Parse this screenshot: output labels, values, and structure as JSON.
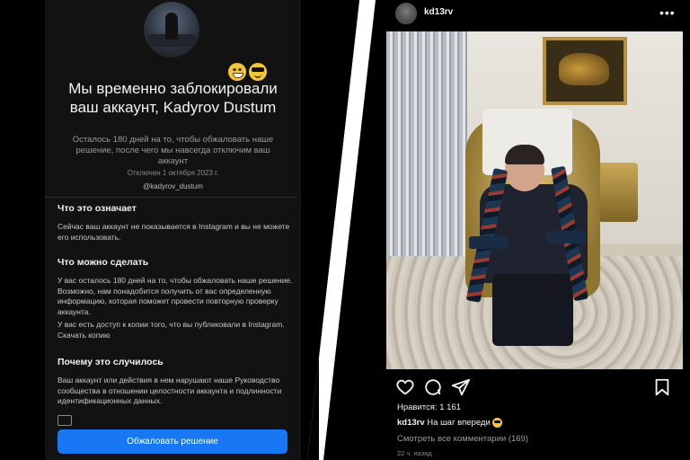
{
  "left_screen": {
    "title": "Мы временно заблокировали ваш аккаунт, Kadyrov Dustum",
    "subtitle": "Осталось 180 дней на то, чтобы обжаловать наше решение, после чего мы навсегда отключим ваш аккаунт",
    "disabled_date": "Отключен 1 октября 2023 г.",
    "handle": "@kadyrov_dustum",
    "sections": [
      {
        "heading": "Что это означает",
        "paragraphs": [
          "Сейчас ваш аккаунт не показывается в Instagram и вы не можете его использовать."
        ]
      },
      {
        "heading": "Что можно сделать",
        "paragraphs": [
          "У вас осталось 180 дней на то, чтобы обжаловать наше решение. Возможно, нам понадобится получить от вас определенную информацию, которая поможет провести повторную проверку аккаунта.",
          "У вас есть доступ к копии того, что вы публиковали в Instagram."
        ],
        "link": "Скачать копию"
      },
      {
        "heading": "Почему это случилось",
        "paragraphs": [
          "Ваш аккаунт или действия в нем нарушают наше Руководство сообщества в отношении целостности аккаунта и подлинности идентификационных данных."
        ]
      }
    ],
    "appeal_button": "Обжаловать решение",
    "emoji_icons": [
      "grinning-face-icon",
      "sunglasses-face-icon"
    ]
  },
  "right_screen": {
    "username": "kd13rv",
    "more_icon": "more-horizontal-icon",
    "actions": [
      "heart-icon",
      "comment-icon",
      "share-icon",
      "bookmark-icon"
    ],
    "likes": "Нравится: 1 161",
    "caption_user": "kd13rv",
    "caption_text": "На шаг впереди",
    "view_comments": "Смотреть все комментарии (169)",
    "time": "22 ч. назад"
  },
  "colors": {
    "background": "#000000",
    "panel": "#121212",
    "button": "#1877f2",
    "muted_text": "#9a9a9a"
  }
}
